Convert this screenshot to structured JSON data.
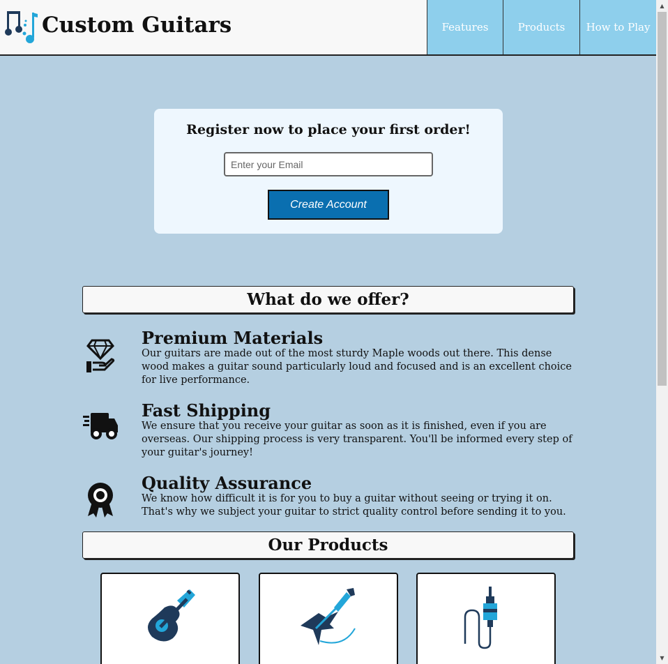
{
  "header": {
    "brand": "Custom Guitars",
    "logo_icon": "music-notes-icon",
    "nav": [
      "Features",
      "Products",
      "How to Play"
    ]
  },
  "register": {
    "title": "Register now to place your first order!",
    "email_placeholder": "Enter your Email",
    "button_label": "Create Account"
  },
  "offer": {
    "heading": "What do we offer?",
    "features": [
      {
        "icon": "diamond-hand-icon",
        "title": "Premium Materials",
        "text": "Our guitars are made out of the most sturdy Maple woods out there. This dense wood makes a guitar sound particularly loud and focused and is an excellent choice for live performance."
      },
      {
        "icon": "shipping-truck-icon",
        "title": "Fast Shipping",
        "text": "We ensure that you receive your guitar as soon as it is finished, even if you are overseas. Our shipping process is very transparent. You'll be informed every step of your guitar's journey!"
      },
      {
        "icon": "award-ribbon-icon",
        "title": "Quality Assurance",
        "text": "We know how difficult it is for you to buy a guitar without seeing or trying it on. That's why we subject your guitar to strict quality control before sending it to you."
      }
    ]
  },
  "products": {
    "heading": "Our Products",
    "items": [
      {
        "icon": "acoustic-guitar-icon"
      },
      {
        "icon": "electric-guitar-icon"
      },
      {
        "icon": "audio-cable-jack-icon"
      }
    ]
  },
  "colors": {
    "page_bg": "#b5cfe1",
    "nav_bg": "#8ecfec",
    "button_bg": "#0a6fb0",
    "icon_dark": "#1f3a5a",
    "icon_accent": "#23a6d9"
  }
}
